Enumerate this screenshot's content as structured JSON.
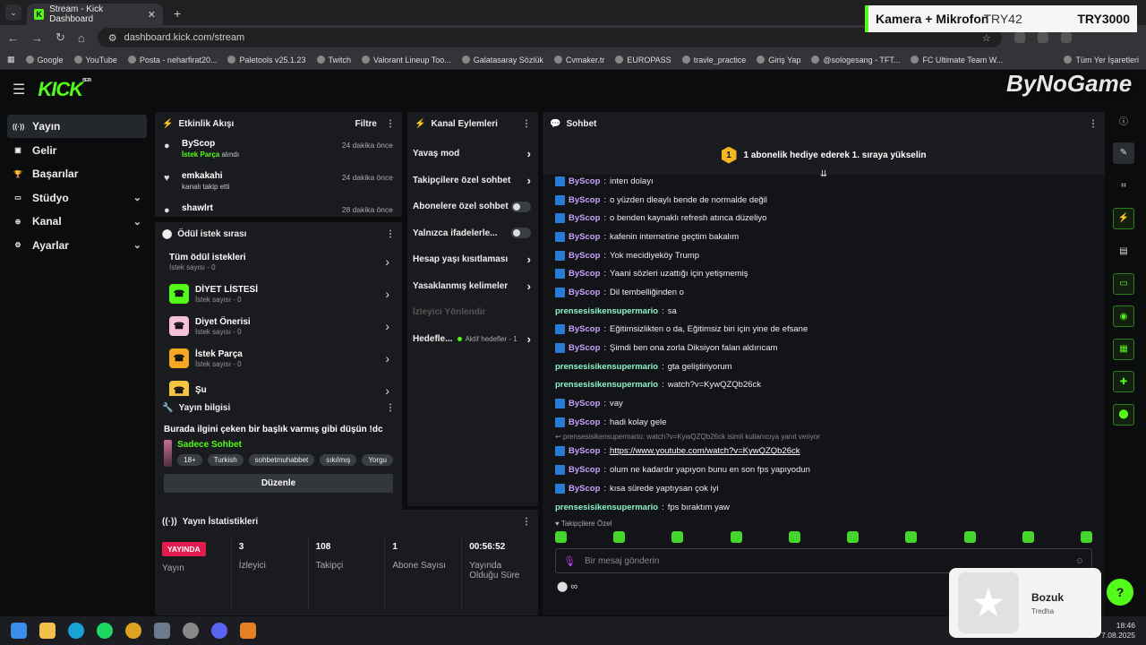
{
  "browser": {
    "tab_title": "Stream - Kick Dashboard",
    "url": "dashboard.kick.com/stream",
    "bookmarks": [
      "Google",
      "YouTube",
      "Posta - neharfirat20...",
      "Paletools v25.1.23",
      "Twitch",
      "Valorant Lineup Too...",
      "Galatasaray Sözlük",
      "Cvmaker.tr",
      "EUROPASS",
      "travle_practice",
      "Giriş Yap",
      "@sologesang - TFT...",
      "FC Ultimate Team W...",
      "Tüm Yer İşaretleri"
    ]
  },
  "stream_overlay": {
    "label": "Kamera + Mikrofon",
    "donation1": "TRY42",
    "donation2": "TRY3000",
    "watermark": "ByNoGame"
  },
  "logo": "KICK",
  "sidebar": {
    "items": [
      {
        "label": "Yayın",
        "active": true,
        "icon": "broadcast-icon"
      },
      {
        "label": "Gelir",
        "icon": "money-icon"
      },
      {
        "label": "Başarılar",
        "icon": "trophy-icon"
      },
      {
        "label": "Stüdyo",
        "expandable": true,
        "icon": "studio-icon"
      },
      {
        "label": "Kanal",
        "expandable": true,
        "icon": "channel-icon"
      },
      {
        "label": "Ayarlar",
        "expandable": true,
        "icon": "settings-icon"
      }
    ]
  },
  "activity": {
    "title": "Etkinlik Akışı",
    "filter": "Filtre",
    "events": [
      {
        "name": "ByScop",
        "highlight": "İstek Parça",
        "sub": "alındı",
        "time": "24 dakika önce"
      },
      {
        "name": "emkakahi",
        "sub": "kanalı takip etti",
        "time": "24 dakika önce"
      },
      {
        "name": "shawlrt",
        "sub": "",
        "time": "28 dakika önce"
      }
    ]
  },
  "rewards": {
    "title": "Ödül istek sırası",
    "all": {
      "title": "Tüm ödül istekleri",
      "count": "İstek sayısı - 0"
    },
    "items": [
      {
        "title": "DİYET LİSTESİ",
        "count": "İstek sayısı - 0",
        "color": "#53fc18"
      },
      {
        "title": "Diyet Önerisi",
        "count": "İstek sayısı - 0",
        "color": "#f7c1d9"
      },
      {
        "title": "İstek Parça",
        "count": "İstek sayısı - 0",
        "color": "#f5a623"
      },
      {
        "title": "Şu",
        "count": "",
        "color": "#f5c542"
      }
    ]
  },
  "channel_actions": {
    "title": "Kanal Eylemleri",
    "items": [
      {
        "label": "Yavaş mod",
        "type": "chevron"
      },
      {
        "label": "Takipçilere özel sohbet",
        "type": "chevron"
      },
      {
        "label": "Abonelere özel sohbet",
        "type": "toggle"
      },
      {
        "label": "Yalnızca ifadelerle...",
        "type": "toggle"
      },
      {
        "label": "Hesap yaşı kısıtlaması",
        "type": "chevron"
      },
      {
        "label": "Yasaklanmış kelimeler",
        "type": "chevron"
      },
      {
        "label": "İzleyici Yönlendir",
        "type": "disabled"
      },
      {
        "label": "Hedefle...",
        "type": "chevron",
        "sub": "Aktif hedefler - 1"
      }
    ]
  },
  "stream_info": {
    "title": "Yayın bilgisi",
    "stream_title": "Burada ilgini çeken bir başlık varmış gibi düşün !dc",
    "category": "Sadece Sohbet",
    "tags": [
      "18+",
      "Turkish",
      "sohbetmuhabbet",
      "sıkılmış",
      "Yorgu"
    ],
    "edit": "Düzenle"
  },
  "stats": {
    "title": "Yayın İstatistikleri",
    "live": "YAYINDA",
    "items": [
      {
        "value": "",
        "label": "Yayın"
      },
      {
        "value": "3",
        "label": "İzleyici"
      },
      {
        "value": "108",
        "label": "Takipçi"
      },
      {
        "value": "1",
        "label": "Abone Sayısı"
      },
      {
        "value": "00:56:52",
        "label": "Yayında Olduğu Süre"
      }
    ]
  },
  "chat": {
    "title": "Sohbet",
    "banner_num": "1",
    "banner": "1 abonelik hediye ederek 1. sıraya yükselin",
    "messages": [
      {
        "user": "ByScop",
        "text": "inten dolayı",
        "badge": true
      },
      {
        "user": "ByScop",
        "text": "o yüzden dleaylı bende de normalde değil",
        "badge": true
      },
      {
        "user": "ByScop",
        "text": "o benden kaynaklı refresh atınca düzeliyo",
        "badge": true
      },
      {
        "user": "ByScop",
        "text": "kafenin internetine geçtim bakalım",
        "badge": true
      },
      {
        "user": "ByScop",
        "text": "Yok mecidiyeköy Trump",
        "badge": true
      },
      {
        "user": "ByScop",
        "text": "Yaani sözleri uzattığı için yetişmemiş",
        "badge": true
      },
      {
        "user": "ByScop",
        "text": "Dil tembelliğinden o",
        "badge": true
      },
      {
        "user": "prensesisikensupermario",
        "text": "sa",
        "badge": false
      },
      {
        "user": "ByScop",
        "text": "Eğitimsizlikten o da, Eğitimsiz biri için yine de efsane",
        "badge": true
      },
      {
        "user": "ByScop",
        "text": "Şimdi ben ona zorla Diksiyon falan aldırıcam",
        "badge": true
      },
      {
        "user": "prensesisikensupermario",
        "text": "gta geliştiriyorum",
        "badge": false
      },
      {
        "user": "prensesisikensupermario",
        "text": "watch?v=KywQZQb26ck",
        "badge": false
      },
      {
        "user": "ByScop",
        "text": "vay",
        "badge": true
      },
      {
        "user": "ByScop",
        "text": "hadi kolay gele",
        "badge": true
      }
    ],
    "reply_note": "↩ prensesisikensupermario: watch?v=KywQZQb26ck isimli kullanıcıya yanıt veriyor",
    "messages2": [
      {
        "user": "ByScop",
        "text": "https://www.youtube.com/watch?v=KywQZQb26ck",
        "badge": true,
        "link": true
      },
      {
        "user": "ByScop",
        "text": "olum ne kadardır yapıyon bunu en son fps yapıyodun",
        "badge": true
      },
      {
        "user": "ByScop",
        "text": "kısa sürede yaptıysan çok iyi",
        "badge": true
      },
      {
        "user": "prensesisikensupermario",
        "text": "fps bıraktım yaw",
        "badge": false
      }
    ],
    "followers_only": "♥ Takipçilere Özel",
    "placeholder": "Bir mesaj gönderin",
    "infinity": "∞"
  },
  "notification": {
    "title": "Bozuk",
    "sub": "Tredha"
  },
  "clock": {
    "time": "18:46",
    "date": "7.08.2025"
  },
  "colors": {
    "accent": "#53fc18",
    "live": "#e31b4e"
  }
}
